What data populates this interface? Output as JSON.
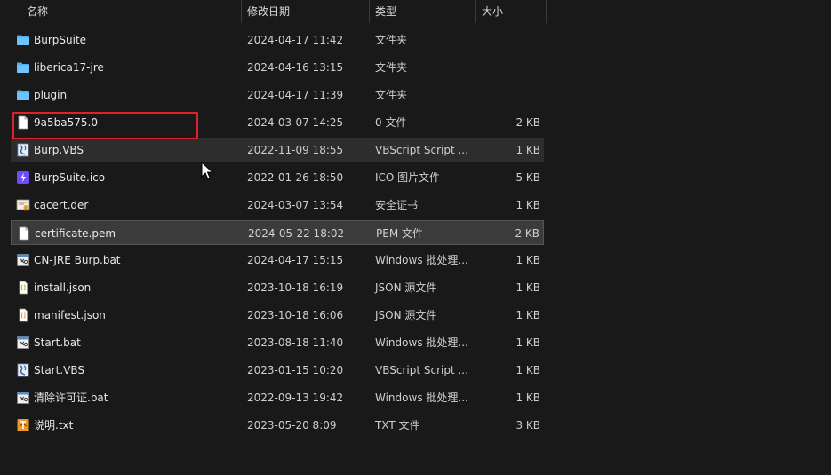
{
  "columns": {
    "name": "名称",
    "date": "修改日期",
    "type": "类型",
    "size": "大小"
  },
  "files": [
    {
      "name": "BurpSuite",
      "date": "2024-04-17 11:42",
      "type": "文件夹",
      "size": "",
      "icon": "folder-icon"
    },
    {
      "name": "liberica17-jre",
      "date": "2024-04-16 13:15",
      "type": "文件夹",
      "size": "",
      "icon": "folder-icon"
    },
    {
      "name": "plugin",
      "date": "2024-04-17 11:39",
      "type": "文件夹",
      "size": "",
      "icon": "folder-icon"
    },
    {
      "name": "9a5ba575.0",
      "date": "2024-03-07 14:25",
      "type": "0 文件",
      "size": "2 KB",
      "icon": "blank-file-icon"
    },
    {
      "name": "Burp.VBS",
      "date": "2022-11-09 18:55",
      "type": "VBScript Script ...",
      "size": "1 KB",
      "icon": "vbscript-file-icon"
    },
    {
      "name": "BurpSuite.ico",
      "date": "2022-01-26 18:50",
      "type": "ICO 图片文件",
      "size": "5 KB",
      "icon": "burp-ico-file-icon"
    },
    {
      "name": "cacert.der",
      "date": "2024-03-07 13:54",
      "type": "安全证书",
      "size": "1 KB",
      "icon": "certificate-file-icon"
    },
    {
      "name": "certificate.pem",
      "date": "2024-05-22 18:02",
      "type": "PEM 文件",
      "size": "2 KB",
      "icon": "blank-file-icon"
    },
    {
      "name": "CN-JRE Burp.bat",
      "date": "2024-04-17 15:15",
      "type": "Windows 批处理...",
      "size": "1 KB",
      "icon": "batch-file-icon"
    },
    {
      "name": "install.json",
      "date": "2023-10-18 16:19",
      "type": "JSON 源文件",
      "size": "1 KB",
      "icon": "json-file-icon"
    },
    {
      "name": "manifest.json",
      "date": "2023-10-18 16:06",
      "type": "JSON 源文件",
      "size": "1 KB",
      "icon": "json-file-icon"
    },
    {
      "name": "Start.bat",
      "date": "2023-08-18 11:40",
      "type": "Windows 批处理...",
      "size": "1 KB",
      "icon": "batch-file-icon"
    },
    {
      "name": "Start.VBS",
      "date": "2023-01-15 10:20",
      "type": "VBScript Script ...",
      "size": "1 KB",
      "icon": "vbscript-file-icon"
    },
    {
      "name": "清除许可证.bat",
      "date": "2022-09-13 19:42",
      "type": "Windows 批处理...",
      "size": "1 KB",
      "icon": "batch-file-icon"
    },
    {
      "name": "说明.txt",
      "date": "2023-05-20 8:09",
      "type": "TXT 文件",
      "size": "3 KB",
      "icon": "text-file-icon"
    }
  ],
  "state": {
    "hovered_row": "Burp.VBS",
    "selected_row": "certificate.pem",
    "annotated_row": "9a5ba575.0"
  },
  "colors": {
    "background": "#191919",
    "annotation": "#e0202a",
    "folder": "#4fb0f0"
  }
}
